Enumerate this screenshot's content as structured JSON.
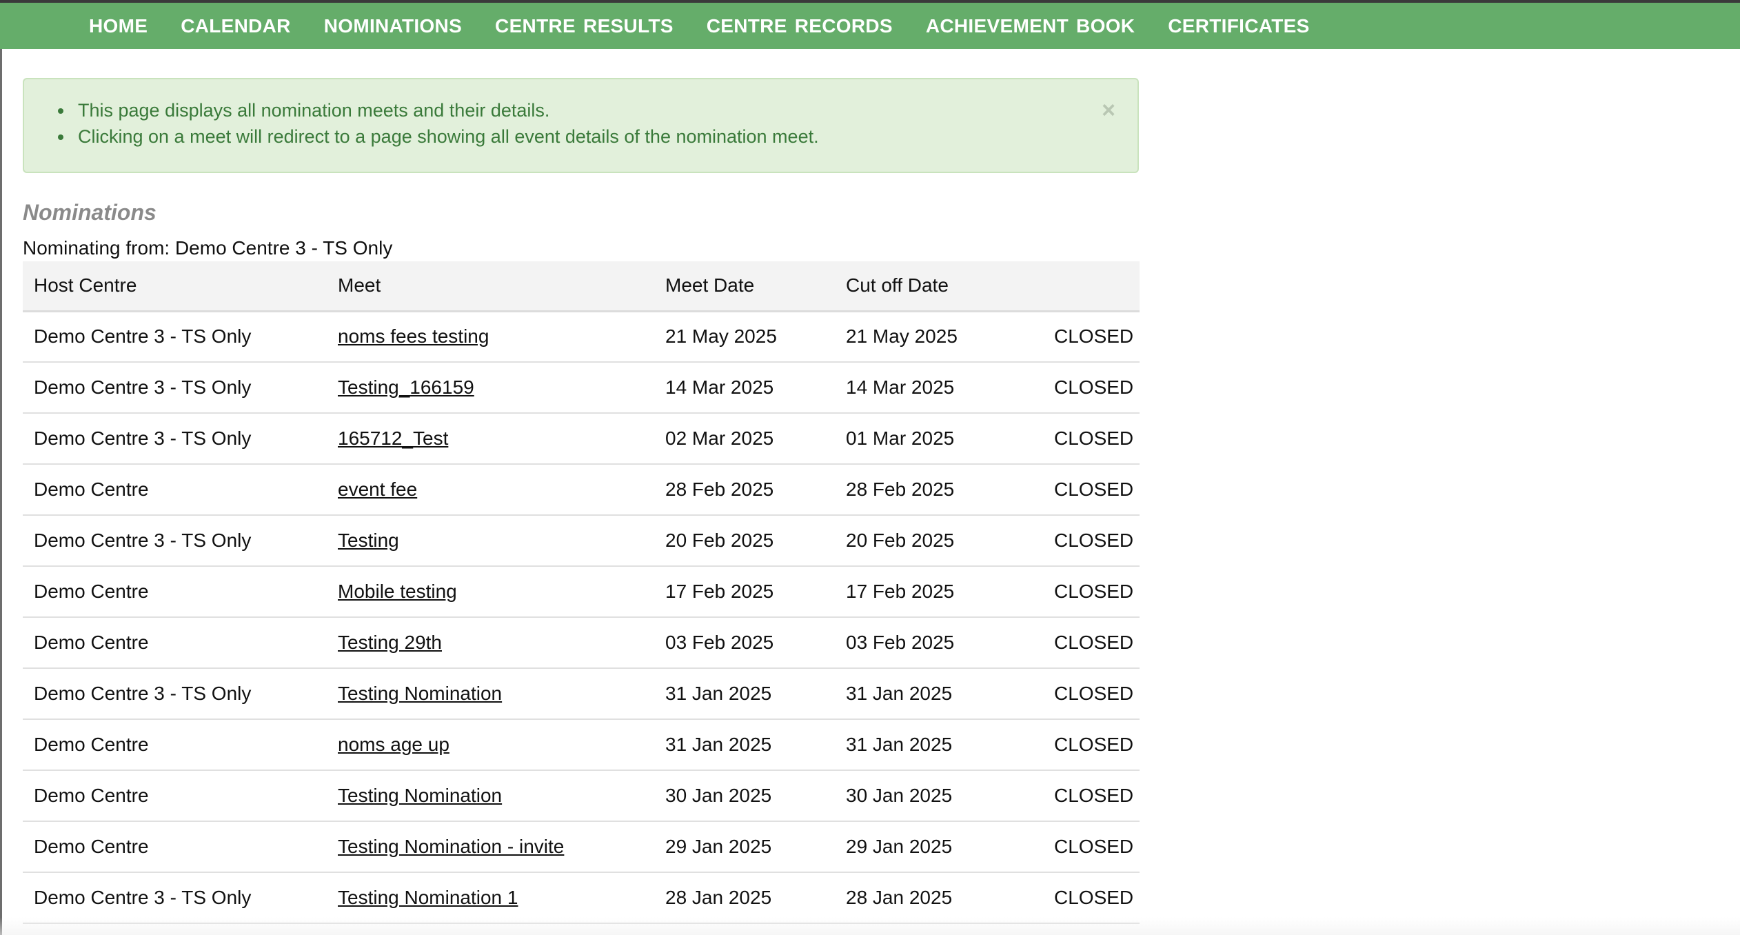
{
  "nav": {
    "items": [
      {
        "label": "HOME",
        "name": "nav-home"
      },
      {
        "label": "CALENDAR",
        "name": "nav-calendar"
      },
      {
        "label": "NOMINATIONS",
        "name": "nav-nominations"
      },
      {
        "label": "CENTRE RESULTS",
        "name": "nav-centre-results"
      },
      {
        "label": "CENTRE RECORDS",
        "name": "nav-centre-records"
      },
      {
        "label": "ACHIEVEMENT BOOK",
        "name": "nav-achievement-book"
      },
      {
        "label": "CERTIFICATES",
        "name": "nav-certificates"
      }
    ],
    "background_color": "#65ad6a"
  },
  "alert": {
    "items": [
      "This page displays all nomination meets and their details.",
      "Clicking on a meet will redirect to a page showing all event details of the nomination meet."
    ],
    "close_symbol": "×",
    "background_color": "#e2f0db",
    "text_color": "#3a7a3a"
  },
  "section": {
    "title": "Nominations",
    "nominating_from": "Nominating from: Demo Centre 3 - TS Only"
  },
  "table": {
    "headers": [
      "Host Centre",
      "Meet",
      "Meet Date",
      "Cut off Date",
      ""
    ],
    "rows": [
      {
        "host": "Demo Centre 3 - TS Only",
        "meet": "noms fees testing",
        "meet_date": "21 May 2025",
        "cutoff": "21 May 2025",
        "status": "CLOSED"
      },
      {
        "host": "Demo Centre 3 - TS Only",
        "meet": "Testing_166159",
        "meet_date": "14 Mar 2025",
        "cutoff": "14 Mar 2025",
        "status": "CLOSED"
      },
      {
        "host": "Demo Centre 3 - TS Only",
        "meet": "165712_Test",
        "meet_date": "02 Mar 2025",
        "cutoff": "01 Mar 2025",
        "status": "CLOSED"
      },
      {
        "host": "Demo Centre",
        "meet": "event fee",
        "meet_date": "28 Feb 2025",
        "cutoff": "28 Feb 2025",
        "status": "CLOSED"
      },
      {
        "host": "Demo Centre 3 - TS Only",
        "meet": "Testing",
        "meet_date": "20 Feb 2025",
        "cutoff": "20 Feb 2025",
        "status": "CLOSED"
      },
      {
        "host": "Demo Centre",
        "meet": "Mobile testing",
        "meet_date": "17 Feb 2025",
        "cutoff": "17 Feb 2025",
        "status": "CLOSED"
      },
      {
        "host": "Demo Centre",
        "meet": "Testing 29th",
        "meet_date": "03 Feb 2025",
        "cutoff": "03 Feb 2025",
        "status": "CLOSED"
      },
      {
        "host": "Demo Centre 3 - TS Only",
        "meet": "Testing Nomination",
        "meet_date": "31 Jan 2025",
        "cutoff": "31 Jan 2025",
        "status": "CLOSED"
      },
      {
        "host": "Demo Centre",
        "meet": "noms age up",
        "meet_date": "31 Jan 2025",
        "cutoff": "31 Jan 2025",
        "status": "CLOSED"
      },
      {
        "host": "Demo Centre",
        "meet": "Testing Nomination",
        "meet_date": "30 Jan 2025",
        "cutoff": "30 Jan 2025",
        "status": "CLOSED"
      },
      {
        "host": "Demo Centre",
        "meet": "Testing Nomination - invite",
        "meet_date": "29 Jan 2025",
        "cutoff": "29 Jan 2025",
        "status": "CLOSED"
      },
      {
        "host": "Demo Centre 3 - TS Only",
        "meet": "Testing Nomination 1",
        "meet_date": "28 Jan 2025",
        "cutoff": "28 Jan 2025",
        "status": "CLOSED"
      }
    ]
  }
}
